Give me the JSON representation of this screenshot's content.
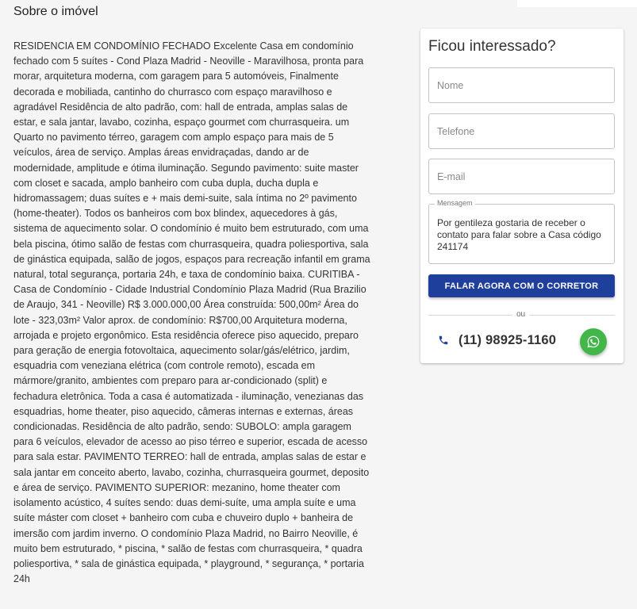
{
  "section": {
    "title": "Sobre o imóvel",
    "description": "RESIDENCIA EM CONDOMÍNIO FECHADO Excelente Casa em condomínio fechado com 5 suítes - Cond Plaza Madrid - Neoville - Maravilhosa, pronta para morar, arquitetura moderna, com garagem para 5 automóveis, Finalmente decorada e mobiliada, cantinho do churrasco com espaço maravilhoso e agradável Residência de alto padrão, com: hall de entrada, amplas salas de estar, e sala jantar, lavabo, cozinha, espaço gourmet com churrasqueira. um Quarto no pavimento térreo, garagem com amplo espaço para mais de 5 veículos, área de serviço. Amplas áreas envidraçadas, dando ar de modernidade, amplitude e ótima iluminação. Segundo pavimento: suite master com closet e sacada, amplo banheiro com cuba dupla, ducha dupla e hidromassagem; duas suítes e + mais demi-suite, sala íntima no 2º pavimento (home-theater). Todos os banheiros com box blindex, aquecedores à gás, sistema de aquecimento solar. O condomínio é muito bem estruturado, com uma bela piscina, ótimo salão de festas com churrasqueira, quadra poliesportiva, sala de ginástica equipada, salão de jogos, espaços para recreação infantil em grama natural, total segurança, portaria 24h, e taxa de condomínio baixa. CURITIBA - Casa de Condomínio - Cidade Industrial Condomínio Plaza Madrid (Rua Brazilio de Araujo, 341 - Neoville) R$ 3.000.000,00 Área construída: 500,00m² Área do lote - 323,03m² Valor aprox. de condomínio: R$700,00 Arquitetura moderna, arrojada e projeto ergonômico. Esta residência oferece piso aquecido, preparo para geração de energia fotovoltaica, aquecimento solar/gás/elétrico, jardim, esquadria com veneziana elétrica (com controle remoto), escada em mármore/granito, ambientes com preparo para ar-condicionado (split) e fechadura eletrônica. Toda a casa é automatizada - iluminação, venezianas das esquadrias, home theater, piso aquecido, câmeras internas e externas, áreas condicionadas. Residência de alto padrão, sendo: SUBOLO: ampla garagem para 6 veículos, elevador de acesso ao piso térreo e superior, escada de acesso para sala estar. PAVIMENTO TERREO: hall de entrada, amplas salas de estar e sala jantar em conceito aberto, lavabo, cozinha, churrasqueira gourmet, deposito e área de serviço. PAVIMENTO SUPERIOR: mezanino, home theater com isolamento acústico, 4 suítes sendo: duas demi-suíte, uma ampla suíte e uma suíte máster com closet + banheiro com cuba e chuveiro duplo + banheira de imersão com jardim inverno. O condomínio Plaza Madrid, no Bairro Neoville, é muito bem estruturado, * piscina, * salão de festas com churrasqueira, * quadra poliesportiva, * sala de ginástica equipada, * playground, * segurança, * portaria 24h"
  },
  "contact_form": {
    "title": "Ficou interessado?",
    "name_placeholder": "Nome",
    "phone_placeholder": "Telefone",
    "email_placeholder": "E-mail",
    "message_label": "Mensagem",
    "message_value": "Por gentileza gostaria de receber o contato para falar sobre a Casa código 241174",
    "submit_label": "FALAR AGORA COM O CORRETOR",
    "or_text": "ou",
    "phone_number": "(11) 98925-1160",
    "phone_icon": "phone-icon",
    "whatsapp_icon": "whatsapp-icon"
  },
  "colors": {
    "accent": "#1e3f9b",
    "whatsapp": "#43b649",
    "phone_icon": "#1e3f9b"
  }
}
